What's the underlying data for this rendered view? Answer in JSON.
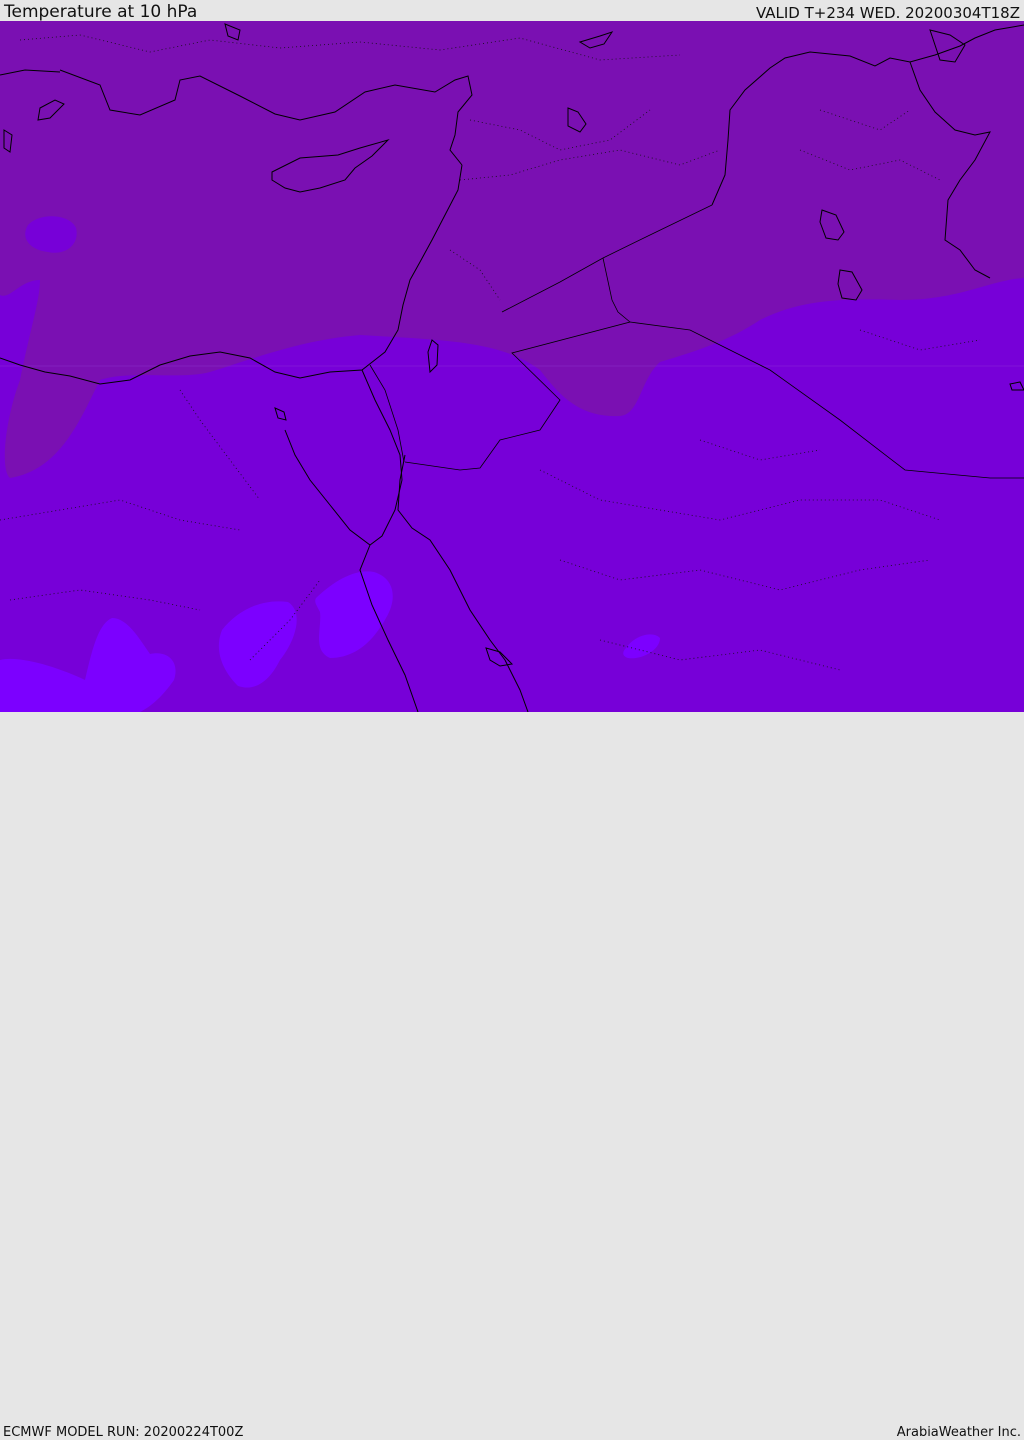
{
  "header": {
    "title": "Temperature at 10 hPa",
    "valid": "VALID T+234 WED. 20200304T18Z"
  },
  "footer": {
    "model_run": "ECMWF MODEL RUN: 20200224T00Z",
    "credit": "ArabiaWeather Inc."
  },
  "map": {
    "region": "Eastern Mediterranean / Middle East",
    "colors": {
      "cold_band": "#7a10b2",
      "base": "#7700d8",
      "warm_patches": "#7c00ff",
      "coastline": "#000000"
    }
  }
}
